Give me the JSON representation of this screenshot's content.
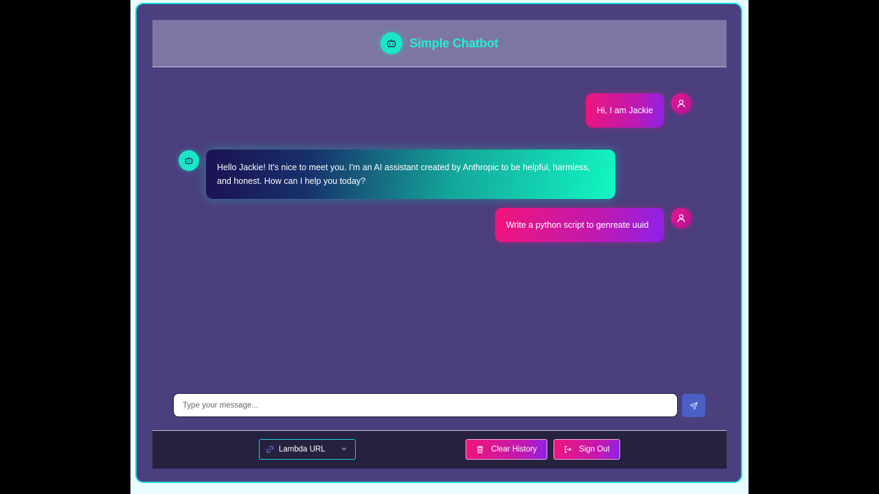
{
  "header": {
    "title": "Simple Chatbot",
    "logo_icon": "robot-icon"
  },
  "messages": [
    {
      "role": "user",
      "text": "Hi, I am Jackie",
      "icon": "user-icon"
    },
    {
      "role": "bot",
      "text": "Hello Jackie! It's nice to meet you. I'm an AI assistant created by Anthropic to be helpful, harmless, and honest. How can I help you today?",
      "icon": "robot-icon"
    },
    {
      "role": "user",
      "text": "Write a python script to genreate uuid",
      "icon": "user-icon"
    }
  ],
  "composer": {
    "placeholder": "Type your message...",
    "value": "",
    "send_icon": "send-icon"
  },
  "footer": {
    "endpoint_select": {
      "selected": "Lambda URL",
      "icon": "link-icon"
    },
    "clear_label": "Clear History",
    "signout_label": "Sign Out"
  },
  "colors": {
    "accent_cyan": "#1ae6c8",
    "accent_pink": "#f0157a",
    "accent_purple": "#8d22e8",
    "panel_bg": "#4b3f7e",
    "header_bg": "#7d76a4",
    "footer_bg": "#26213f"
  }
}
